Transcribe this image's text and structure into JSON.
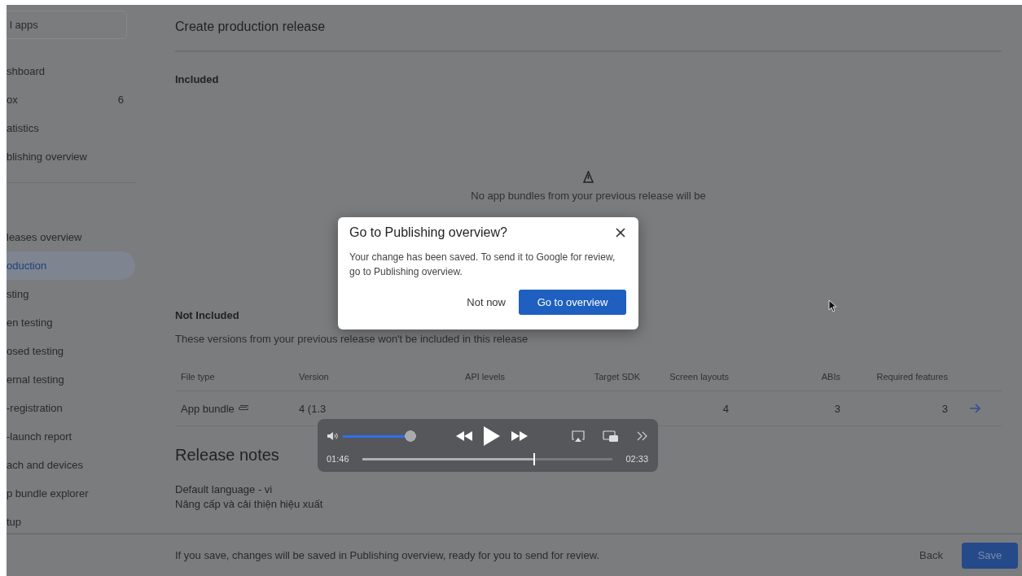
{
  "sidebar": {
    "search": {
      "value": "l apps"
    },
    "top_items": [
      {
        "label": "shboard",
        "selected": false
      },
      {
        "label": "ox",
        "badge": "6",
        "selected": false
      },
      {
        "label": "atistics",
        "selected": false
      },
      {
        "label": "blishing overview",
        "selected": false
      }
    ],
    "release_items": [
      {
        "label": "leases overview",
        "selected": false
      },
      {
        "label": "oduction",
        "selected": true
      },
      {
        "label": "sting",
        "selected": false
      },
      {
        "label": "en testing",
        "selected": false
      },
      {
        "label": "osed testing",
        "selected": false
      },
      {
        "label": "ernal testing",
        "selected": false
      },
      {
        "label": "-registration",
        "selected": false
      },
      {
        "label": "-launch report",
        "selected": false
      },
      {
        "label": "ach and devices",
        "selected": false
      },
      {
        "label": "p bundle explorer",
        "selected": false
      },
      {
        "label": "tup",
        "selected": false
      }
    ]
  },
  "main": {
    "title": "Create production release",
    "included": {
      "heading": "Included",
      "empty_message": "No app bundles from your previous release will be"
    },
    "not_included": {
      "heading": "Not Included",
      "description": "These versions from your previous release won't be included in this release",
      "columns": [
        "File type",
        "Version",
        "API levels",
        "Target SDK",
        "Screen layouts",
        "ABIs",
        "Required features"
      ],
      "rows": [
        {
          "file_type": "App bundle",
          "version": "4 (1.3",
          "screen_layouts": "4",
          "abis": "3",
          "required_features": "3"
        }
      ]
    },
    "release_notes": {
      "heading": "Release notes",
      "language": "Default language - vi",
      "text": "Nâng cấp và cải thiện hiệu xuất"
    }
  },
  "footer": {
    "message": "If you save, changes will be saved in Publishing overview, ready for you to send for review.",
    "back": "Back",
    "save": "Save"
  },
  "dialog": {
    "title": "Go to Publishing overview?",
    "body": "Your change has been saved. To send it to Google for review, go to Publishing overview.",
    "secondary": "Not now",
    "primary": "Go to overview"
  },
  "player": {
    "volume": {
      "level": 1
    },
    "progress": {
      "level": 0.69
    },
    "elapsed": "01:46",
    "duration": "02:33"
  }
}
